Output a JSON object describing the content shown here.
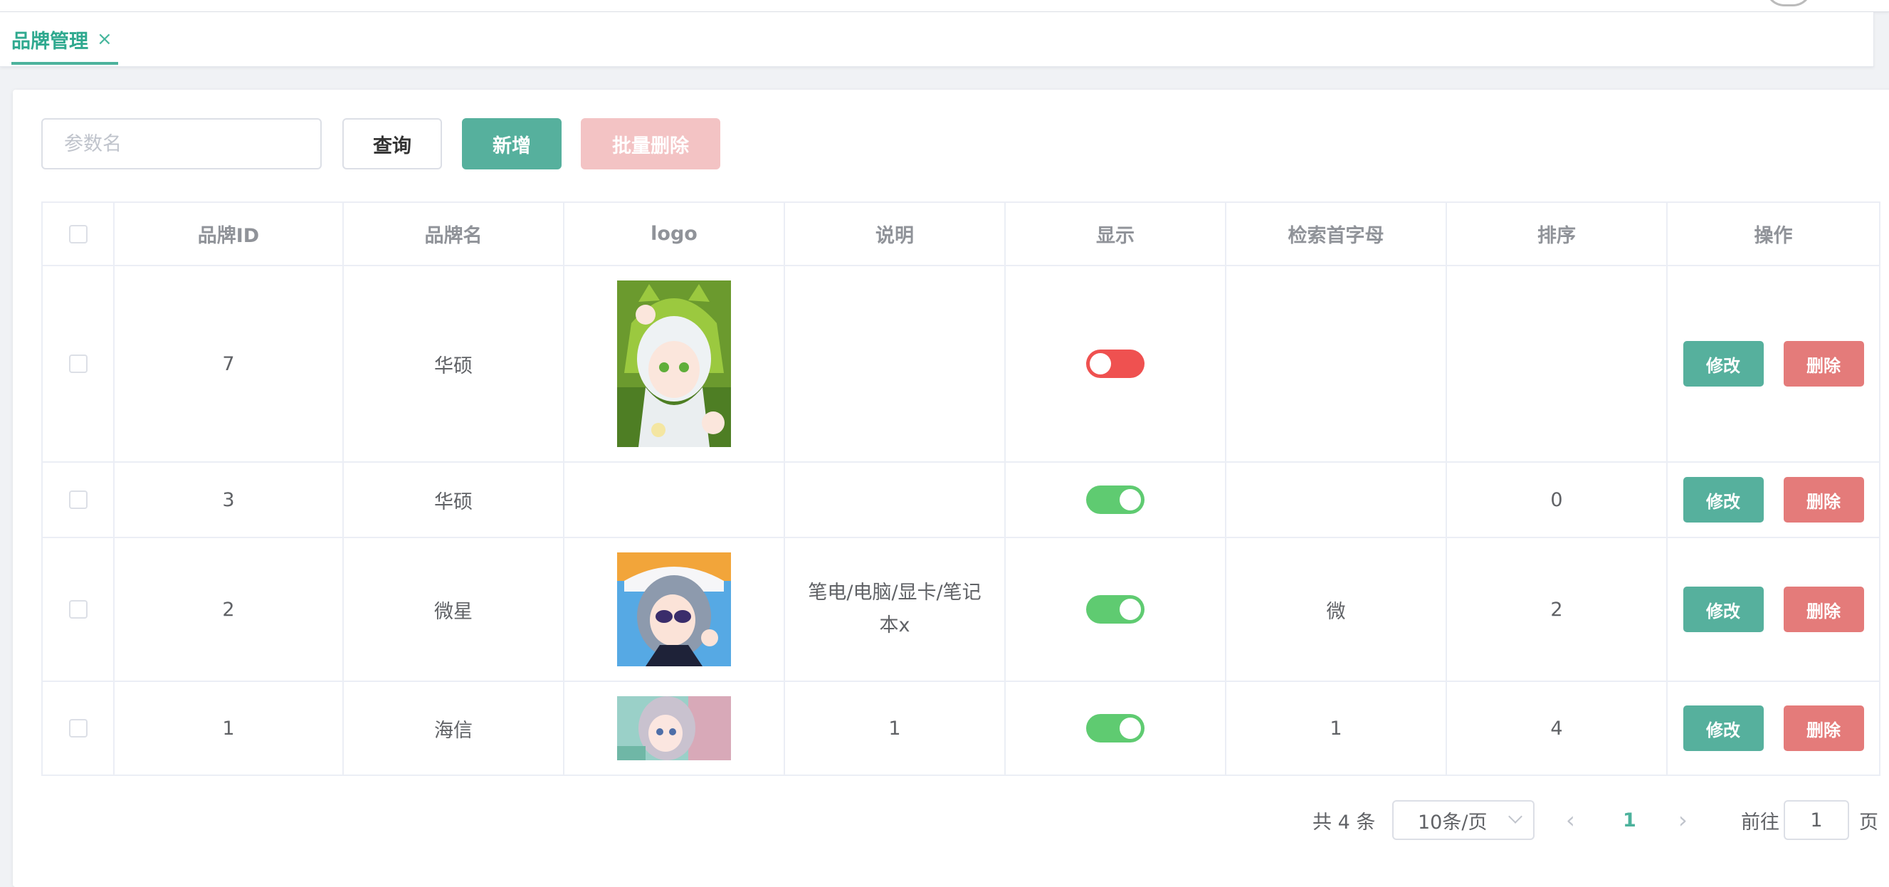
{
  "tags": {
    "active_label": "品牌管理",
    "close_glyph": "×"
  },
  "toolbar": {
    "search_placeholder": "参数名",
    "query_label": "查询",
    "add_label": "新增",
    "batch_delete_label": "批量删除"
  },
  "table": {
    "columns": [
      "品牌ID",
      "品牌名",
      "logo",
      "说明",
      "显示",
      "检索首字母",
      "排序",
      "操作"
    ],
    "rows": [
      {
        "id": "7",
        "name": "华硕",
        "logo": "anime-girl-green-hood-image",
        "desc": "",
        "show": false,
        "letter": "",
        "sort": ""
      },
      {
        "id": "3",
        "name": "华硕",
        "logo": "",
        "desc": "",
        "show": true,
        "letter": "",
        "sort": "0"
      },
      {
        "id": "2",
        "name": "微星",
        "logo": "anime-girl-sunglasses-beach-image",
        "desc": "笔电/电脑/显卡/笔记本x",
        "show": true,
        "letter": "微",
        "sort": "2"
      },
      {
        "id": "1",
        "name": "海信",
        "logo": "anime-girl-pink-hair-image",
        "desc": "1",
        "show": true,
        "letter": "1",
        "sort": "4"
      }
    ],
    "edit_label": "修改",
    "delete_label": "删除"
  },
  "pagination": {
    "total_text": "共 4 条",
    "page_size": "10条/页",
    "current_page": "1",
    "goto_label": "前往",
    "goto_value": "1",
    "page_suffix": "页"
  },
  "colors": {
    "accent": "#56b09d",
    "danger": "#e47b7a",
    "switch_on": "#5fcb71",
    "switch_off": "#ef5150"
  }
}
